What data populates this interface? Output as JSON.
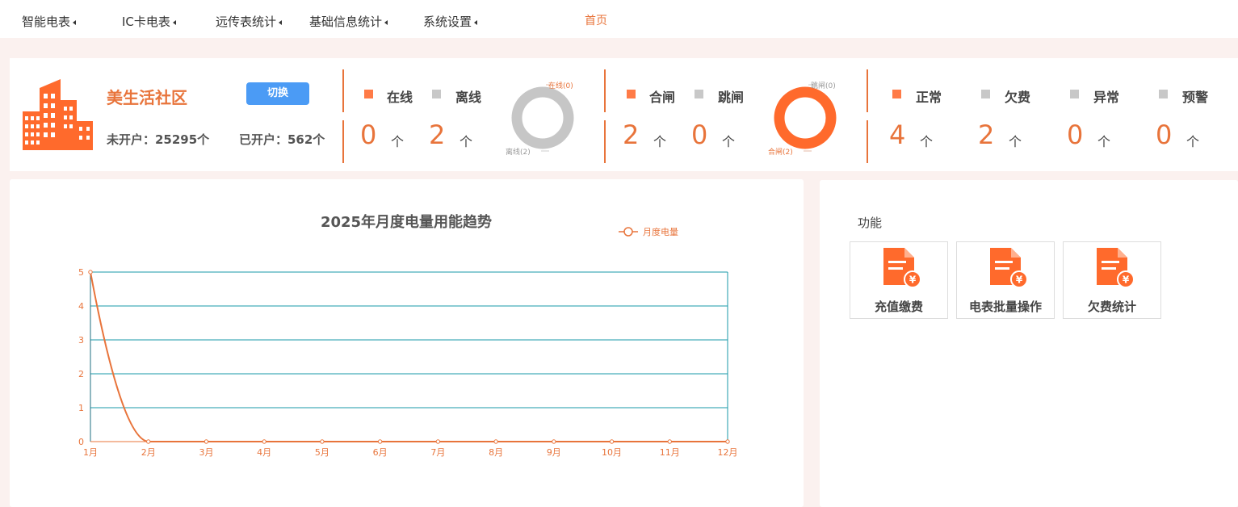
{
  "nav": {
    "items": [
      {
        "label": "智能电表"
      },
      {
        "label": "IC卡电表"
      },
      {
        "label": "远传表统计"
      },
      {
        "label": "基础信息统计"
      },
      {
        "label": "系统设置"
      }
    ],
    "home": "首页"
  },
  "community": {
    "name": "美生活社区",
    "switch_label": "切换",
    "unopened": "未开户：25295个",
    "opened": "已开户：562个"
  },
  "online_status": {
    "online_label": "在线",
    "offline_label": "离线",
    "online_count": "0",
    "offline_count": "2",
    "unit": "个",
    "ring_online": "在线(0)",
    "ring_offline": "离线(2)"
  },
  "switch_status": {
    "closed_label": "合闸",
    "tripped_label": "跳闸",
    "closed_count": "2",
    "tripped_count": "0",
    "unit": "个",
    "ring_tripped": "跳闸(0)",
    "ring_closed": "合闸(2)"
  },
  "account_status": {
    "normal_label": "正常",
    "arrears_label": "欠费",
    "abnormal_label": "异常",
    "warning_label": "预警",
    "normal_count": "4",
    "arrears_count": "2",
    "abnormal_count": "0",
    "warning_count": "0",
    "unit": "个"
  },
  "chart_data": {
    "type": "line",
    "title": "2025年月度电量用能趋势",
    "categories": [
      "1月",
      "2月",
      "3月",
      "4月",
      "5月",
      "6月",
      "7月",
      "8月",
      "9月",
      "10月",
      "11月",
      "12月"
    ],
    "series": [
      {
        "name": "月度电量",
        "values": [
          5,
          0,
          0,
          0,
          0,
          0,
          0,
          0,
          0,
          0,
          0,
          0
        ]
      }
    ],
    "ylim": [
      0,
      5
    ],
    "yticks": [
      0,
      1,
      2,
      3,
      4,
      5
    ],
    "grid": true,
    "legend": "top-right",
    "colors": {
      "line": "#e8743b",
      "grid": "#1a9aa8",
      "axis_text": "#e8743b"
    }
  },
  "functions": {
    "title": "功能",
    "tiles": [
      {
        "label": "充值缴费"
      },
      {
        "label": "电表批量操作"
      },
      {
        "label": "欠费统计"
      }
    ]
  },
  "colors": {
    "accent": "#e8743b",
    "button": "#4b9bf5",
    "gray": "#c8c8c8"
  }
}
